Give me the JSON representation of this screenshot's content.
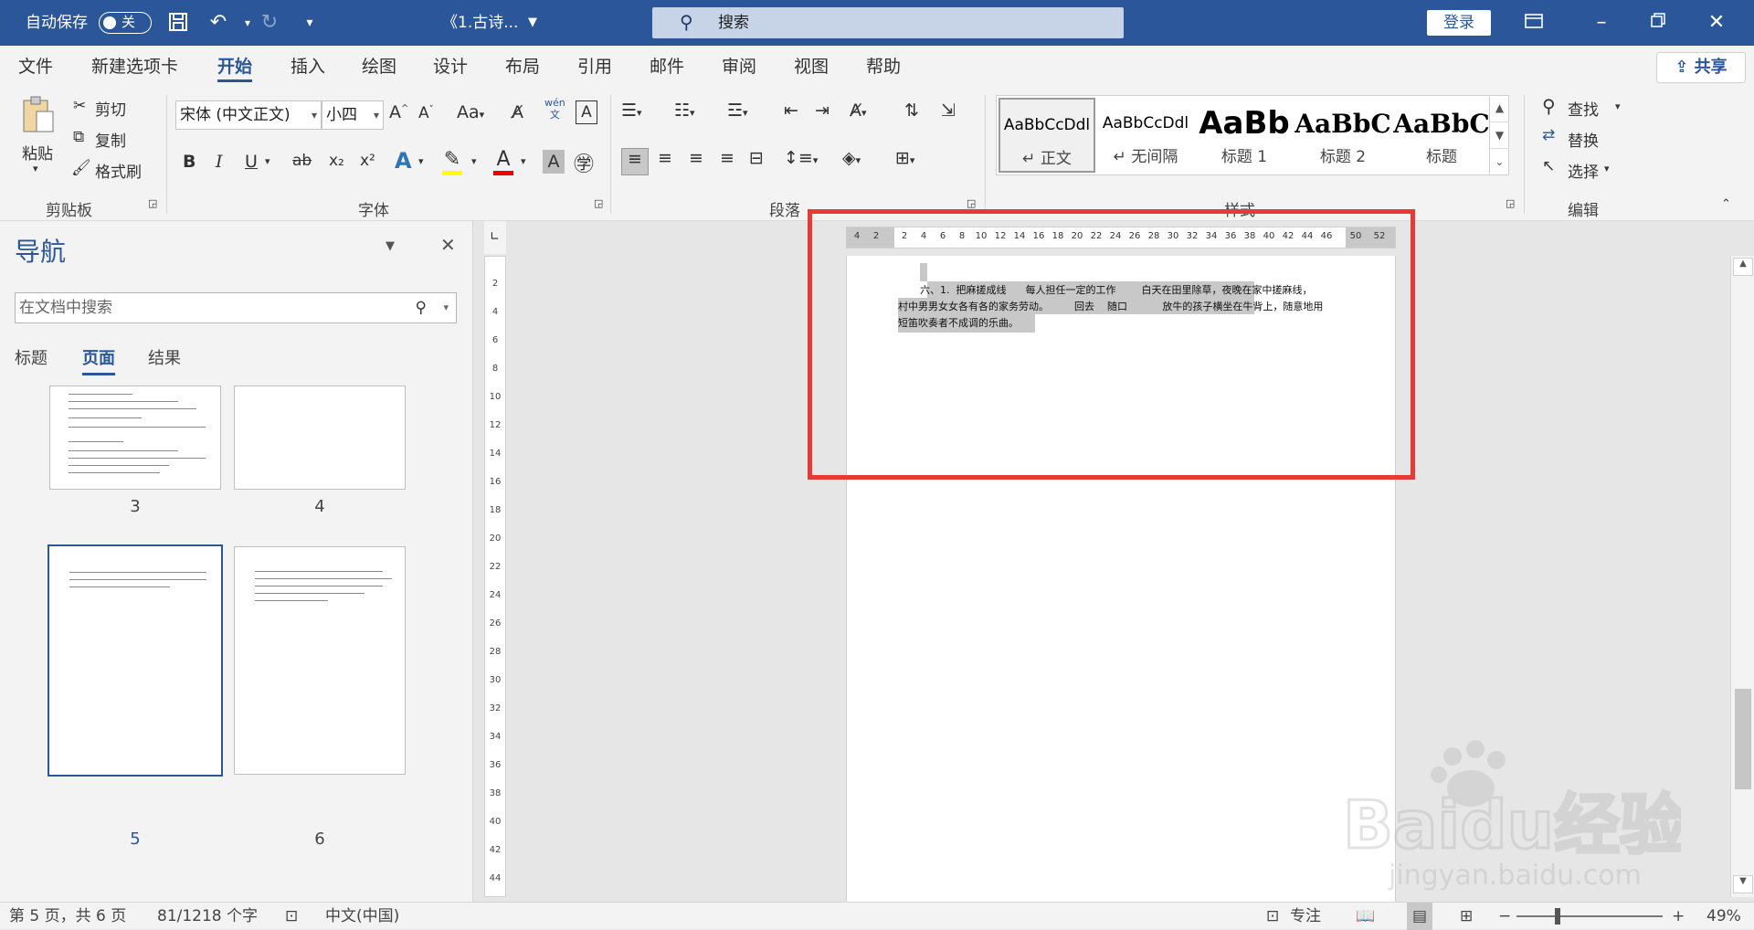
{
  "titlebar": {
    "autosave_label": "自动保存",
    "autosave_state": "关",
    "doc_title": "《1.古诗...",
    "search_label": "搜索",
    "login_label": "登录"
  },
  "tabs": [
    "文件",
    "新建选项卡",
    "开始",
    "插入",
    "绘图",
    "设计",
    "布局",
    "引用",
    "邮件",
    "审阅",
    "视图",
    "帮助"
  ],
  "active_tab": "开始",
  "share_label": "共享",
  "clipboard": {
    "group": "剪贴板",
    "paste": "粘贴",
    "cut": "剪切",
    "copy": "复制",
    "format_painter": "格式刷"
  },
  "font": {
    "group": "字体",
    "name": "宋体 (中文正文)",
    "size": "小四",
    "bold": "B",
    "italic": "I",
    "underline": "U",
    "strike": "ab",
    "sub": "x₂",
    "sup": "x²",
    "aa": "Aa",
    "wen": "wén",
    "wen_sub": "文"
  },
  "paragraph": {
    "group": "段落"
  },
  "styles": {
    "group": "样式",
    "items": [
      {
        "preview": "AaBbCcDdl",
        "name": "↵ 正文"
      },
      {
        "preview": "AaBbCcDdl",
        "name": "↵ 无间隔"
      },
      {
        "preview": "AaBb",
        "name": "标题 1"
      },
      {
        "preview": "AaBbC",
        "name": "标题 2"
      },
      {
        "preview": "AaBbC",
        "name": "标题"
      }
    ]
  },
  "editing": {
    "group": "编辑",
    "find": "查找",
    "replace": "替换",
    "select": "选择"
  },
  "nav": {
    "title": "导航",
    "search_placeholder": "在文档中搜索",
    "tabs": [
      "标题",
      "页面",
      "结果"
    ],
    "active_tab": "页面",
    "pages": [
      "3",
      "4",
      "5",
      "6"
    ],
    "selected_page": "5"
  },
  "ruler": {
    "h_ticks": [
      "4",
      "2",
      "2",
      "4",
      "6",
      "8",
      "10",
      "12",
      "14",
      "16",
      "18",
      "20",
      "22",
      "24",
      "26",
      "28",
      "30",
      "32",
      "34",
      "36",
      "38",
      "40",
      "42",
      "44",
      "46",
      "50",
      "52"
    ],
    "v_ticks": [
      "2",
      "4",
      "6",
      "8",
      "10",
      "12",
      "14",
      "16",
      "18",
      "20",
      "22",
      "24",
      "26",
      "28",
      "30",
      "32",
      "34",
      "36",
      "38",
      "40",
      "42",
      "44"
    ]
  },
  "document": {
    "line1": "六、1.  把麻搓成线      每人担任一定的工作        白天在田里除草，夜晚在家中搓麻线，",
    "line2": "村中男男女女各有各的家务劳动。        回去    随口           放牛的孩子横坐在牛背上，随意地用",
    "line3": "短笛吹奏者不成调的乐曲。"
  },
  "status": {
    "page": "第 5 页，共 6 页",
    "words": "81/1218 个字",
    "language": "中文(中国)",
    "focus": "专注",
    "zoom": "49%"
  },
  "watermark": {
    "brand": "Baidu经验",
    "url": "jingyan.baidu.com"
  },
  "colors": {
    "accent": "#2b579a",
    "highlight_box": "#e53a3a",
    "selection": "#c8c8c8"
  }
}
